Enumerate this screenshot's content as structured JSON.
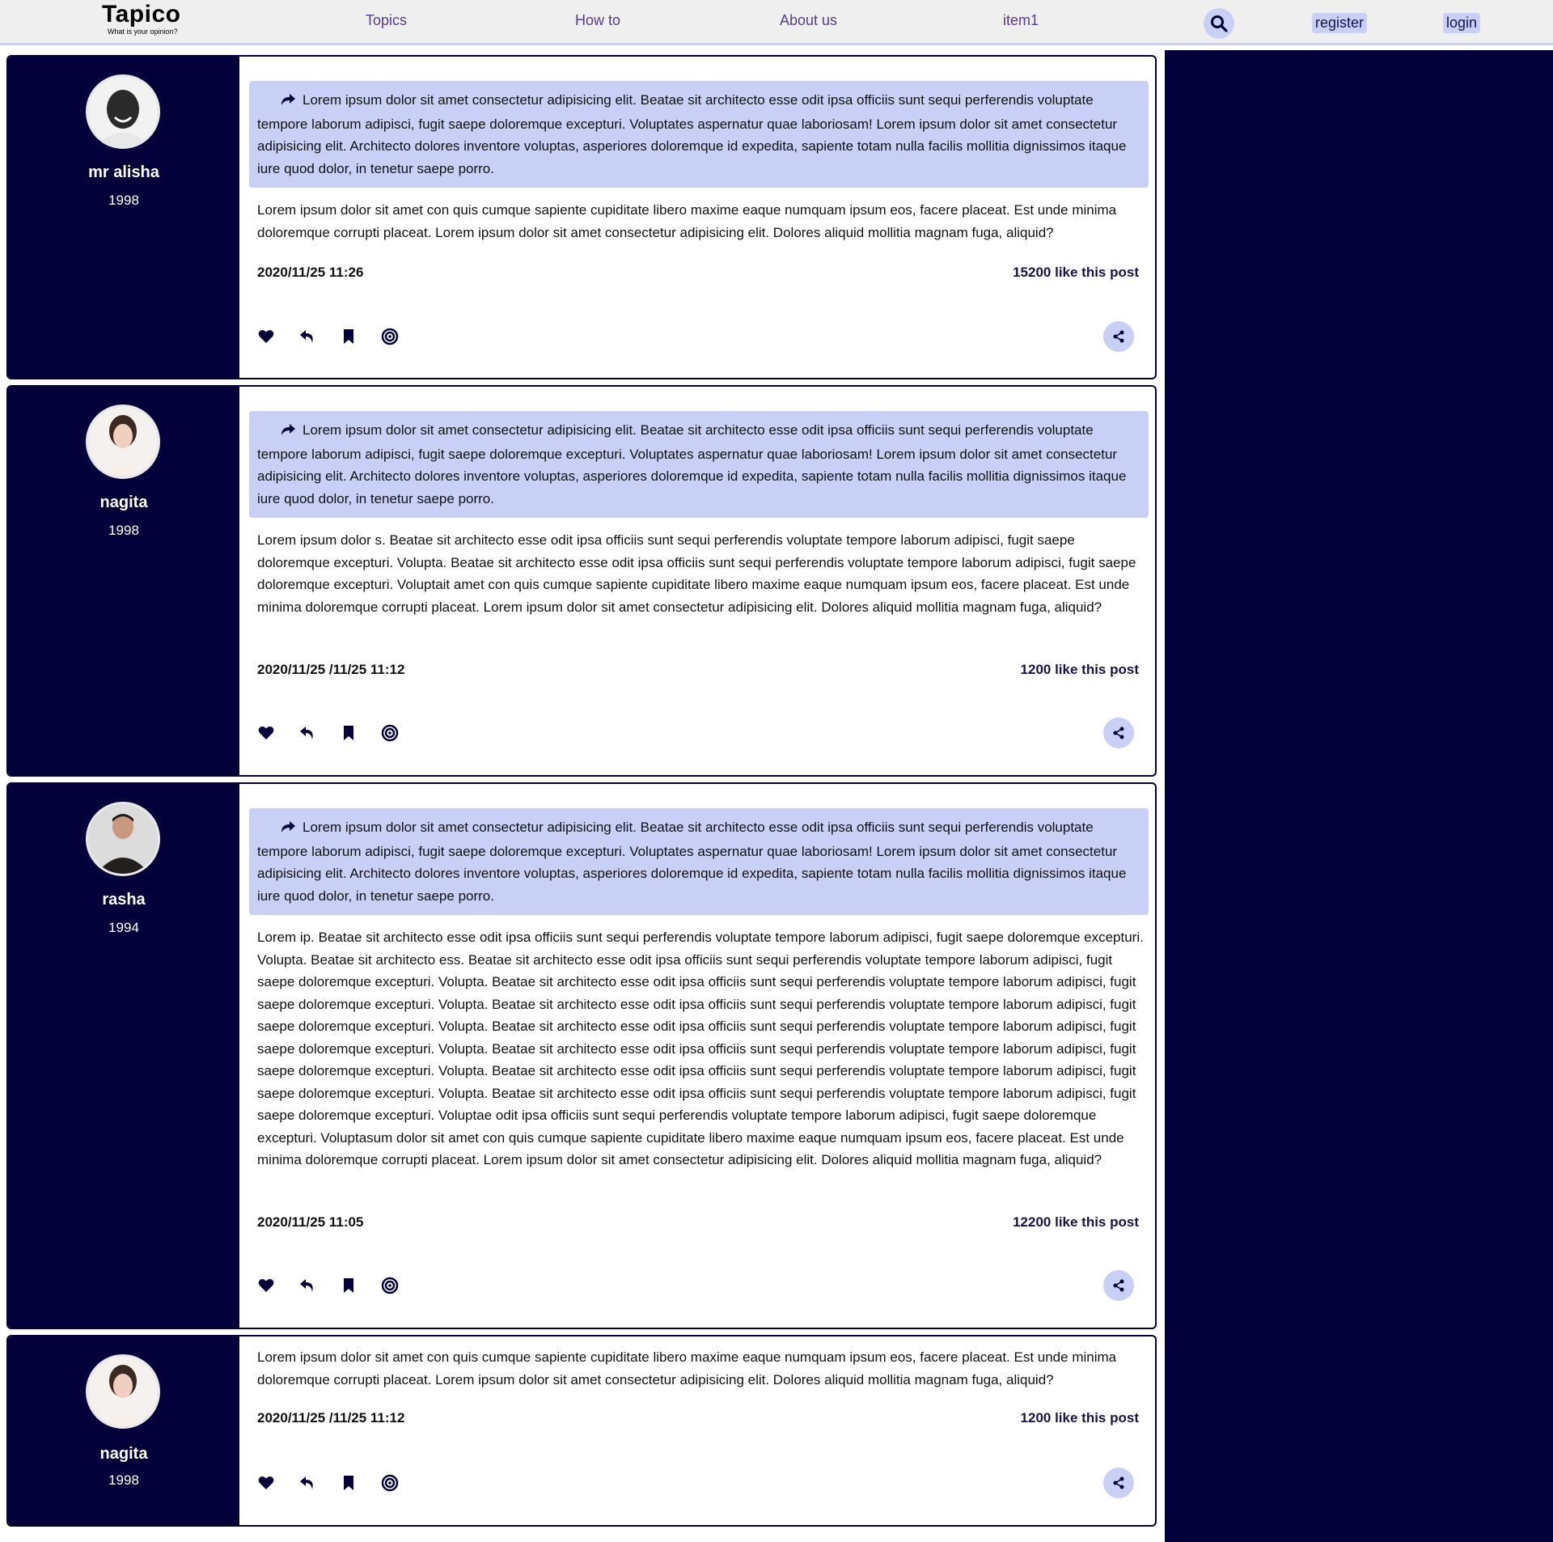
{
  "header": {
    "logo": "Tapico",
    "tagline": "What is your opinion?",
    "nav": [
      "Topics",
      "How to",
      "About us",
      "item1"
    ],
    "register": "register",
    "login": "login"
  },
  "quote_text": "Lorem ipsum dolor sit amet consectetur adipisicing elit. Beatae sit architecto esse odit ipsa officiis sunt sequi perferendis voluptate tempore laborum adipisci, fugit saepe doloremque excepturi. Voluptates aspernatur quae laboriosam! Lorem ipsum dolor sit amet consectetur adipisicing elit. Architecto dolores inventore voluptas, asperiores doloremque id expedita, sapiente totam nulla facilis mollitia dignissimos itaque iure quod dolor, in tenetur saepe porro.",
  "posts": [
    {
      "user": "mr alisha",
      "year": "1998",
      "body": "Lorem ipsum dolor sit amet con quis cumque sapiente cupiditate libero maxime eaque numquam ipsum eos, facere placeat. Est unde minima doloremque corrupti placeat. Lorem ipsum dolor sit amet consectetur adipisicing elit. Dolores aliquid mollitia magnam fuga, aliquid?",
      "date": "2020/11/25 11:26",
      "likes": "15200 like this post"
    },
    {
      "user": "nagita",
      "year": "1998",
      "body": "Lorem ipsum dolor s. Beatae sit architecto esse odit ipsa officiis sunt sequi perferendis voluptate tempore laborum adipisci, fugit saepe doloremque excepturi. Volupta. Beatae sit architecto esse odit ipsa officiis sunt sequi perferendis voluptate tempore laborum adipisci, fugit saepe doloremque excepturi. Voluptait amet con quis cumque sapiente cupiditate libero maxime eaque numquam ipsum eos, facere placeat. Est unde minima doloremque corrupti placeat. Lorem ipsum dolor sit amet consectetur adipisicing elit. Dolores aliquid mollitia magnam fuga, aliquid?",
      "date": "2020/11/25 /11/25 11:12",
      "likes": "1200 like this post"
    },
    {
      "user": "rasha",
      "year": "1994",
      "body": "Lorem ip. Beatae sit architecto esse odit ipsa officiis sunt sequi perferendis voluptate tempore laborum adipisci, fugit saepe doloremque excepturi. Volupta. Beatae sit architecto ess. Beatae sit architecto esse odit ipsa officiis sunt sequi perferendis voluptate tempore laborum adipisci, fugit saepe doloremque excepturi. Volupta. Beatae sit architecto esse odit ipsa officiis sunt sequi perferendis voluptate tempore laborum adipisci, fugit saepe doloremque excepturi. Volupta. Beatae sit architecto esse odit ipsa officiis sunt sequi perferendis voluptate tempore laborum adipisci, fugit saepe doloremque excepturi. Volupta. Beatae sit architecto esse odit ipsa officiis sunt sequi perferendis voluptate tempore laborum adipisci, fugit saepe doloremque excepturi. Volupta. Beatae sit architecto esse odit ipsa officiis sunt sequi perferendis voluptate tempore laborum adipisci, fugit saepe doloremque excepturi. Volupta. Beatae sit architecto esse odit ipsa officiis sunt sequi perferendis voluptate tempore laborum adipisci, fugit saepe doloremque excepturi. Volupta. Beatae sit architecto esse odit ipsa officiis sunt sequi perferendis voluptate tempore laborum adipisci, fugit saepe doloremque excepturi. Voluptae odit ipsa officiis sunt sequi perferendis voluptate tempore laborum adipisci, fugit saepe doloremque excepturi. Voluptasum dolor sit amet con quis cumque sapiente cupiditate libero maxime eaque numquam ipsum eos, facere placeat. Est unde minima doloremque corrupti placeat. Lorem ipsum dolor sit amet consectetur adipisicing elit. Dolores aliquid mollitia magnam fuga, aliquid?",
      "date": "2020/11/25 11:05",
      "likes": "12200 like this post"
    },
    {
      "user": "nagita",
      "year": "1998",
      "body": "Lorem ipsum dolor sit amet con quis cumque sapiente cupiditate libero maxime eaque numquam ipsum eos, facere placeat. Est unde minima doloremque corrupti placeat. Lorem ipsum dolor sit amet consectetur adipisicing elit. Dolores aliquid mollitia magnam fuga, aliquid?",
      "date": "2020/11/25 /11/25 11:12",
      "likes": "1200 like this post"
    }
  ],
  "icons": [
    "search-icon",
    "forward-icon",
    "heart-icon",
    "reply-icon",
    "bookmark-icon",
    "target-icon",
    "share-icon"
  ],
  "colors": {
    "navy": "#03003a",
    "accent": "#c8d0f5",
    "nav_text": "#5b3b8c"
  }
}
